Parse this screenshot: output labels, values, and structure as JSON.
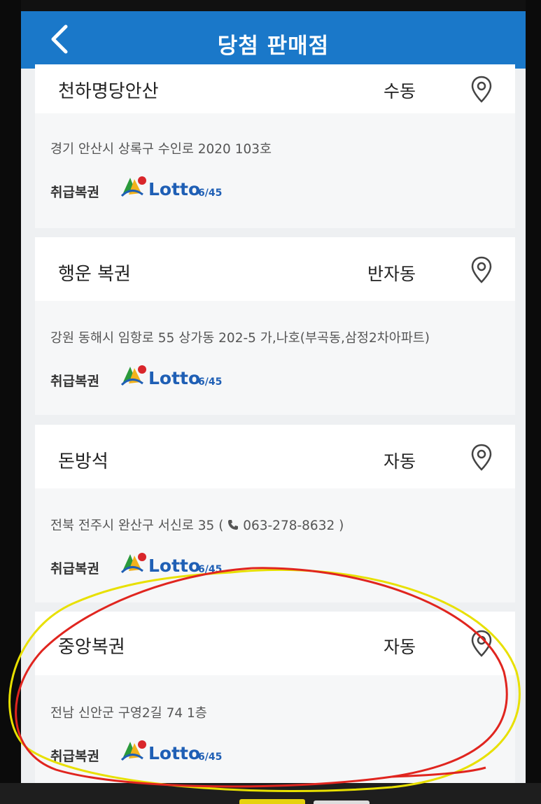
{
  "header": {
    "title": "당첨 판매점",
    "back_icon": "chevron-left-icon"
  },
  "stores": [
    {
      "name": "천하명당안산",
      "type": "수동",
      "address": "경기 안산시 상록구 수인로 2020 103호",
      "phone": "",
      "label": "취급복권",
      "logo": "lotto-645-logo"
    },
    {
      "name": "행운 복권",
      "type": "반자동",
      "address": "강원 동해시 임항로 55 상가동 202-5 가,나호(부곡동,삼정2차아파트)",
      "phone": "",
      "label": "취급복권",
      "logo": "lotto-645-logo"
    },
    {
      "name": "돈방석",
      "type": "자동",
      "address": "전북 전주시 완산구 서신로 35",
      "phone": "063-278-8632",
      "label": "취급복권",
      "logo": "lotto-645-logo"
    },
    {
      "name": "중앙복권",
      "type": "자동",
      "address": "전남 신안군 구영2길 74 1층",
      "phone": "",
      "label": "취급복권",
      "logo": "lotto-645-logo"
    }
  ],
  "logo": {
    "text": "Lotto",
    "sub": "6/45"
  },
  "colors": {
    "header": "#1a78c9",
    "logo_blue": "#1f5fb5",
    "annotation_red": "#e0251f",
    "annotation_yellow": "#e8e000"
  }
}
